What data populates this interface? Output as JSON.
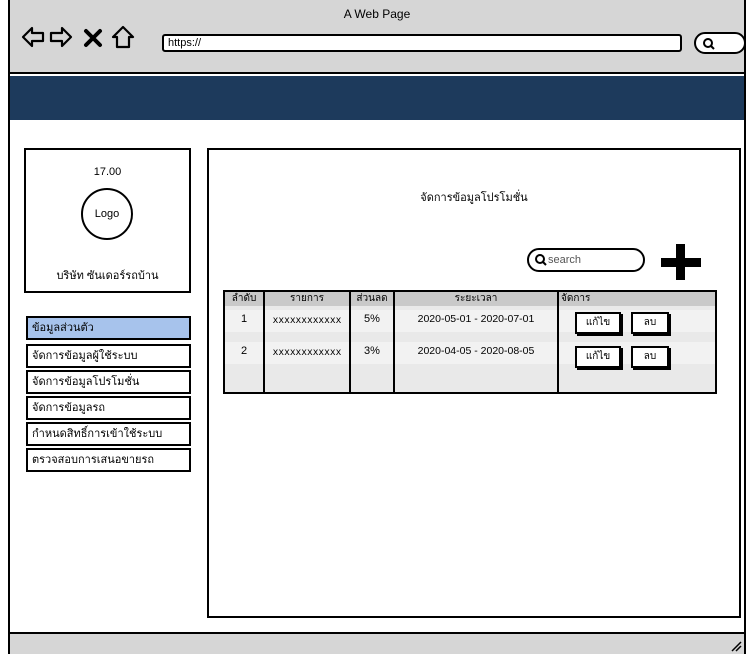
{
  "window": {
    "title": "A Web Page"
  },
  "browser": {
    "url": "https://"
  },
  "profile": {
    "time": "17.00",
    "logo_label": "Logo",
    "company": "บริษัท ซันเดอร์รถบ้าน"
  },
  "sidebar": {
    "items": [
      {
        "label": "ข้อมูลส่วนตัว",
        "active": true
      },
      {
        "label": "จัดการข้อมูลผู้ใช้ระบบ"
      },
      {
        "label": "จัดการข้อมูลโปรโมชั่น"
      },
      {
        "label": "จัดการข้อมูลรถ"
      },
      {
        "label": "กำหนดสิทธิ์การเข้าใช้ระบบ"
      },
      {
        "label": "ตรวจสอบการเสนอขายรถ"
      }
    ]
  },
  "main": {
    "title": "จัดการข้อมูลโปรโมชั่น",
    "search_placeholder": "search",
    "table": {
      "headers": [
        "ลำดับ",
        "รายการ",
        "ส่วนลด",
        "ระยะเวลา",
        "จัดการ"
      ],
      "rows": [
        {
          "no": "1",
          "item": "xxxxxxxxxxxx",
          "discount": "5%",
          "period": "2020-05-01 - 2020-07-01"
        },
        {
          "no": "2",
          "item": "xxxxxxxxxxxx",
          "discount": "3%",
          "period": "2020-04-05 - 2020-08-05"
        }
      ],
      "edit_label": "แก้ไข",
      "delete_label": "ลบ"
    }
  },
  "colors": {
    "header_bar": "#1d3a5c",
    "active_item": "#a7c3ec",
    "chrome": "#d6d6d6"
  },
  "icons": [
    "back-arrow-icon",
    "forward-arrow-icon",
    "close-icon",
    "home-icon",
    "search-icon",
    "plus-icon"
  ]
}
